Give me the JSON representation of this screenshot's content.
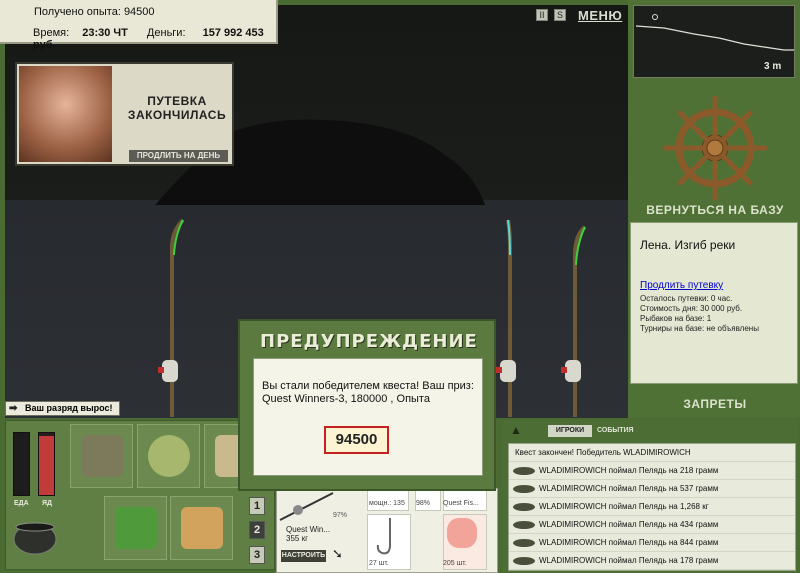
{
  "hud": {
    "xp_label": "Получено опыта:",
    "xp_value": "94500",
    "time_label": "Время:",
    "time_value": "23:30 ЧТ",
    "money_label": "Деньги:",
    "money_value": "157 992 453 руб.",
    "menu_label": "МЕНЮ"
  },
  "ad": {
    "title_line1": "ПУТЕВКА",
    "title_line2": "ЗАКОНЧИЛАСЬ",
    "button": "ПРОДЛИТЬ НА ДЕНЬ"
  },
  "rank_banner": "Ваш разряд вырос!",
  "map": {
    "depth": "3 m"
  },
  "sidebar": {
    "return_label": "ВЕРНУТЬСЯ НА БАЗУ",
    "bans_label": "ЗАПРЕТЫ"
  },
  "base": {
    "title": "Лена. Изгиб реки",
    "extend_link": "Продлить путевку",
    "lines": [
      "Осталось путевки: 0 час.",
      "Стоимость дня: 30 000 руб.",
      "Рыбаков на базе: 1",
      "Турниры на базе: не объявлены"
    ]
  },
  "meters": {
    "food_label": "ЕДА",
    "poison_label": "ЯД",
    "food_level": 0.0,
    "poison_level": 0.95
  },
  "inventory_tabs": [
    "1",
    "2",
    "3"
  ],
  "tackle": {
    "rod_name": "Quest Win...",
    "rod_weight": "355 кг",
    "rod_pct": "97%",
    "cell_labels": [
      "мощн.: 135",
      "98%",
      "Quest Fis..."
    ],
    "counts": [
      "27 шт.",
      "205 шт."
    ],
    "setup_button": "НАСТРОИТЬ"
  },
  "log": {
    "tab_players": "ИГРОКИ",
    "tab_events": "СОБЫТИЯ",
    "rows": [
      "Квест закончен! Победитель WLADIMIROWICH",
      "WLADIMIROWICH поймал Пелядь на 218 грамм",
      "WLADIMIROWICH поймал Пелядь на 537 грамм",
      "WLADIMIROWICH поймал Пелядь на 1,268 кг",
      "WLADIMIROWICH поймал Пелядь на 434 грамм",
      "WLADIMIROWICH поймал Пелядь на 844 грамм",
      "WLADIMIROWICH поймал Пелядь на 178 грамм"
    ]
  },
  "modal": {
    "title": "ПРЕДУПРЕЖДЕНИЕ",
    "message": "Вы стали победителем квеста! Ваш приз: Quest Winners-3, 180000 , Опыта",
    "value": "94500"
  },
  "colors": {
    "panel_green": "#4a6b32",
    "scene_dark": "#141614",
    "warning_red": "#c62020"
  }
}
